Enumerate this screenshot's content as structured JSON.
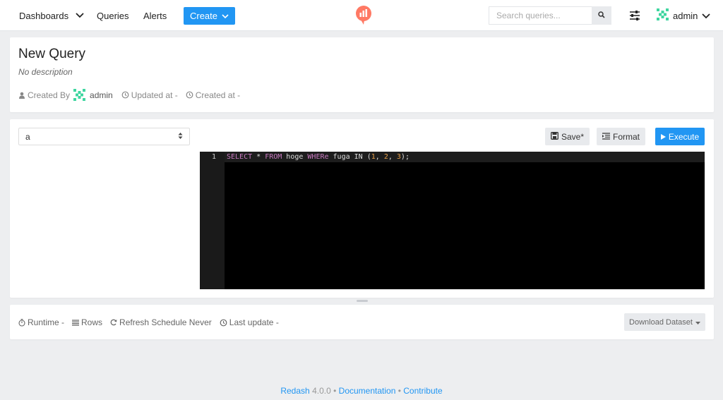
{
  "nav": {
    "dashboards": "Dashboards",
    "queries": "Queries",
    "alerts": "Alerts",
    "create": "Create",
    "search_placeholder": "Search queries...",
    "user": "admin"
  },
  "header": {
    "title": "New Query",
    "description": "No description",
    "created_by_label": "Created By",
    "created_by_user": "admin",
    "updated_at": "Updated at -",
    "created_at": "Created at -"
  },
  "editor": {
    "data_source": "a",
    "save_label": "Save*",
    "format_label": "Format",
    "execute_label": "Execute",
    "line_number": "1",
    "code_tokens": [
      {
        "t": "SELECT",
        "c": "kw"
      },
      {
        "t": " * ",
        "c": "plain"
      },
      {
        "t": "FROM",
        "c": "kw"
      },
      {
        "t": " hoge ",
        "c": "plain"
      },
      {
        "t": "WHERe",
        "c": "kw"
      },
      {
        "t": " fuga IN (",
        "c": "plain"
      },
      {
        "t": "1",
        "c": "num"
      },
      {
        "t": ", ",
        "c": "plain"
      },
      {
        "t": "2",
        "c": "num"
      },
      {
        "t": ", ",
        "c": "plain"
      },
      {
        "t": "3",
        "c": "num"
      },
      {
        "t": ");",
        "c": "plain"
      }
    ]
  },
  "stats": {
    "runtime": "Runtime -",
    "rows": "Rows",
    "refresh": "Refresh Schedule Never",
    "last_update": "Last update -",
    "download": "Download Dataset"
  },
  "footer": {
    "brand": "Redash",
    "version": "4.0.0",
    "documentation": "Documentation",
    "contribute": "Contribute"
  },
  "colors": {
    "primary": "#2196f3",
    "logo": "#ff7964",
    "avatar": "#3fd6a0"
  }
}
